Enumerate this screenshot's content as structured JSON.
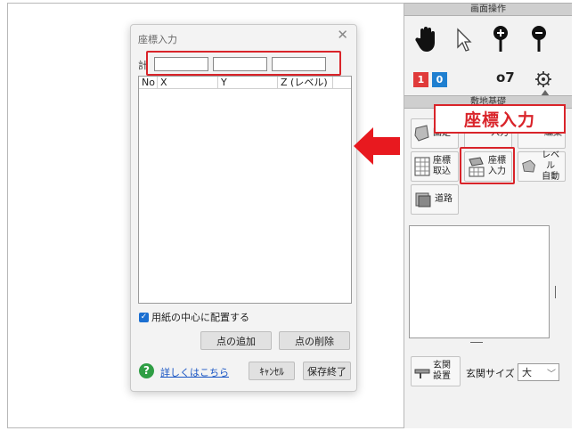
{
  "dialog": {
    "title": "座標入力",
    "close_glyph": "✕",
    "row_label": "計",
    "inputs": [
      {
        "value": "",
        "placeholder": ""
      },
      {
        "value": "",
        "placeholder": ""
      },
      {
        "value": "",
        "placeholder": ""
      }
    ],
    "table_headers": [
      "No",
      "X",
      "Y",
      "Z (レベル)"
    ],
    "center_checkbox": {
      "label": "用紙の中心に配置する",
      "checked": true,
      "check_glyph": "✓"
    },
    "add_point": "点の追加",
    "delete_point": "点の削除",
    "help_glyph": "?",
    "help_link": "詳しくはこちら",
    "cancel": "ｷｬﾝｾﾙ",
    "save_close": "保存終了"
  },
  "panel": {
    "screen_ops_header": "画面操作",
    "layer_badges": [
      {
        "label": "1",
        "color": "#e03a3a"
      },
      {
        "label": "0",
        "color": "#1f7fd0"
      }
    ],
    "o7_label": "o7",
    "site_header": "敷地基礎",
    "callout": "座標入力",
    "buttons": {
      "fix_partial": "固定",
      "input_partial": "入力",
      "edit_partial": "編集",
      "coord_import_1": "座標",
      "coord_import_2": "取込",
      "coord_input_1": "座標",
      "coord_input_2": "入力",
      "level_auto_1": "レベル",
      "level_auto_2": "自動",
      "road": "道路",
      "entrance_1": "玄関",
      "entrance_2": "設置"
    },
    "entrance_size_label": "玄関サイズ",
    "entrance_size_value": "大",
    "select_chevron": "﹀"
  },
  "colors": {
    "highlight_red": "#d9242a",
    "arrow_red": "#e8191f",
    "link_blue": "#1a56c4",
    "help_green": "#2f9e44"
  }
}
